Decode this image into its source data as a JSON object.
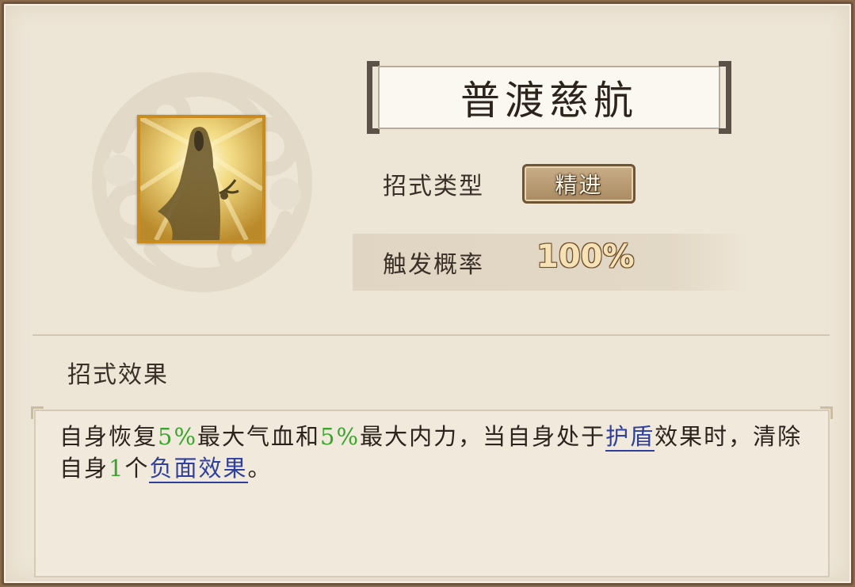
{
  "skill": {
    "name": "普渡慈航",
    "type_label": "招式类型",
    "type_value": "精进",
    "rate_label": "触发概率",
    "rate_value": "100%"
  },
  "effect": {
    "heading": "招式效果",
    "segments": [
      {
        "text": "自身恢复",
        "style": "plain"
      },
      {
        "text": "5%",
        "style": "green"
      },
      {
        "text": "最大气血和",
        "style": "plain"
      },
      {
        "text": "5%",
        "style": "green"
      },
      {
        "text": "最大内力，当自身处于",
        "style": "plain"
      },
      {
        "text": "护盾",
        "style": "link"
      },
      {
        "text": "效果时，清除自身",
        "style": "plain"
      },
      {
        "text": "1",
        "style": "green"
      },
      {
        "text": "个",
        "style": "plain"
      },
      {
        "text": "负面效果",
        "style": "link"
      },
      {
        "text": "。",
        "style": "plain"
      }
    ]
  },
  "colors": {
    "highlight_green": "#3aa52c",
    "link_blue": "#2f3f9c",
    "icon_frame_gold": "#c98a1e"
  },
  "icons": {
    "skill_icon": "robed-figure-radiant-icon",
    "background_deco": "cloud-swirl-icon"
  }
}
